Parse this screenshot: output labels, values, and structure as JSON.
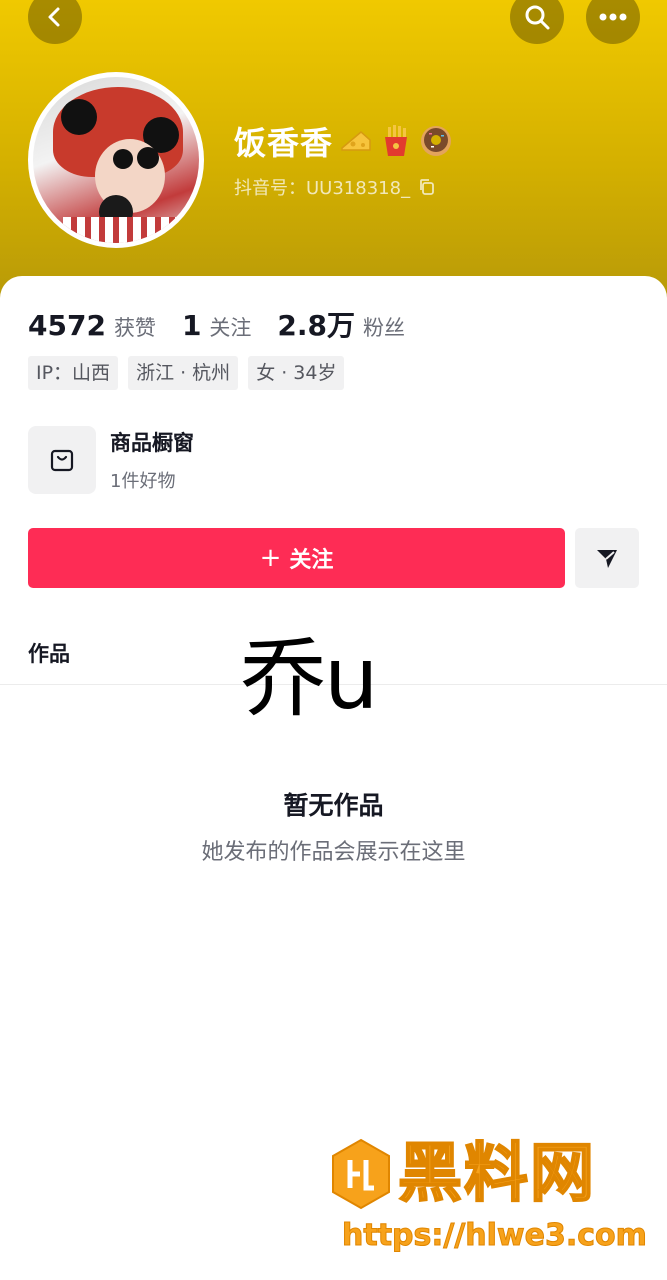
{
  "profile": {
    "nickname": "饭香香",
    "uid_label": "抖音号：",
    "uid_value": "UU318318_",
    "emoji_icons": [
      "cheese-icon",
      "fries-icon",
      "donut-icon"
    ]
  },
  "stats": [
    {
      "num": "4572",
      "label": "获赞"
    },
    {
      "num": "1",
      "label": "关注"
    },
    {
      "num": "2.8万",
      "label": "粉丝"
    }
  ],
  "tags": [
    "IP：山西",
    "浙江 · 杭州",
    "女 · 34岁"
  ],
  "shop": {
    "title": "商品橱窗",
    "subtitle": "1件好物"
  },
  "actions": {
    "follow_label": "关注",
    "follow_plus": "+"
  },
  "tabs": {
    "works": "作品"
  },
  "overlay": {
    "text": "乔u"
  },
  "empty": {
    "title": "暂无作品",
    "subtitle": "她发布的作品会展示在这里"
  },
  "watermark": {
    "brand": "黑料网",
    "url": "https://hlwe3.com"
  },
  "colors": {
    "header": "#f0c900",
    "follow": "#fe2c55",
    "watermark": "#f7a21b"
  }
}
